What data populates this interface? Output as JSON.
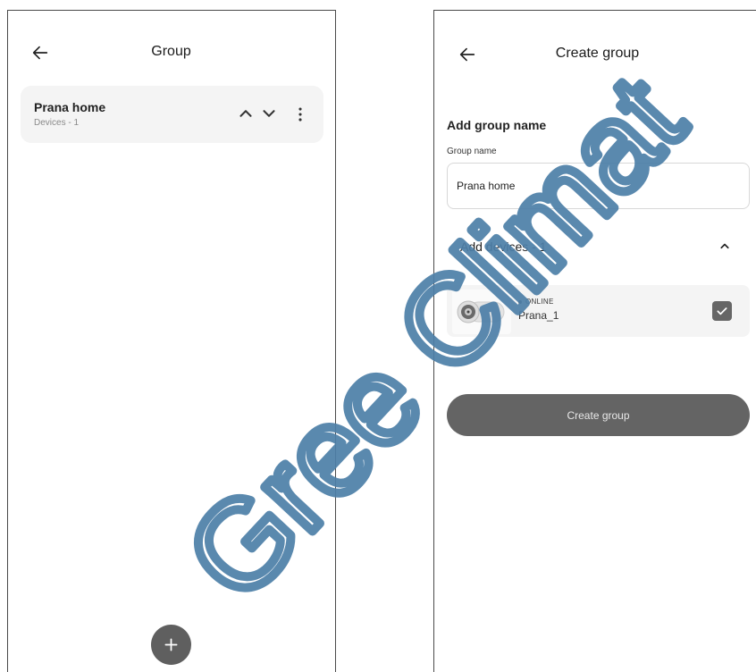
{
  "group_list": {
    "title": "Group",
    "groups": [
      {
        "name": "Prana home",
        "devices_label": "Devices - 1"
      }
    ]
  },
  "create_group": {
    "title": "Create group",
    "section_title": "Add group name",
    "field_label": "Group name",
    "group_name_value": "Prana home",
    "devices_header": "Add devices - 1",
    "devices": [
      {
        "status": "ONLINE",
        "name": "Prana_1",
        "checked": true
      }
    ],
    "create_button": "Create group"
  },
  "watermark": {
    "text": "Gree Climat",
    "color": "#4d7fa8"
  },
  "colors": {
    "card_bg": "#f4f4f4",
    "fab_bg": "#5f5f5f",
    "button_bg": "#646464"
  }
}
